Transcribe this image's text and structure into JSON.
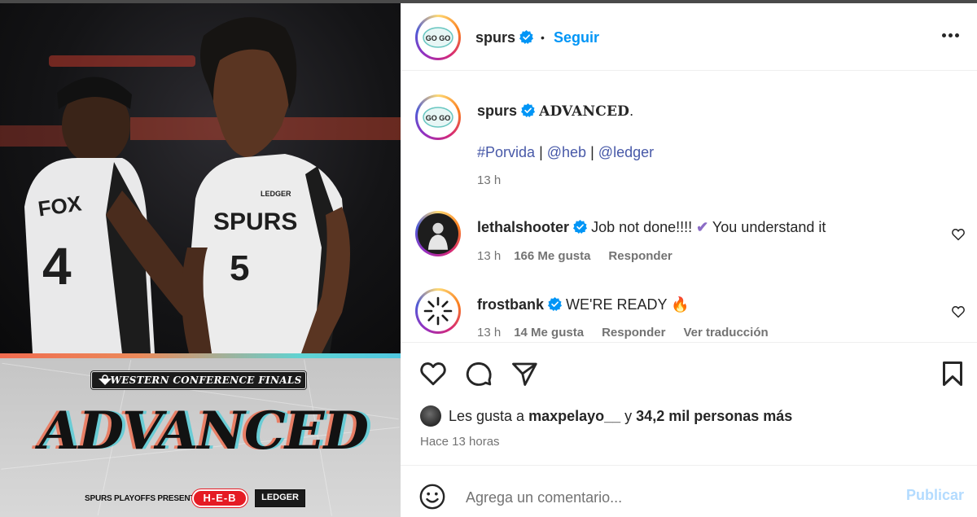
{
  "post_image": {
    "banner_title": "WESTERN CONFERENCE FINALS",
    "headline": "ADVANCED",
    "presented_by": "SPURS PLAYOFFS PRESENTED BY",
    "sponsor_heb": "H-E-B",
    "sponsor_ledger": "LEDGER",
    "jersey_left_name": "FOX",
    "jersey_left_number": "4",
    "jersey_right_team": "SPURS",
    "jersey_right_number": "5",
    "jersey_right_patch": "LEDGER"
  },
  "header": {
    "username": "spurs",
    "separator": "•",
    "follow_label": "Seguir",
    "avatar_text": "GO GO"
  },
  "caption": {
    "username": "spurs",
    "text": "ADVANCED",
    "period": ".",
    "hashtag": "#Porvida",
    "sep1": "|",
    "mention1": "@heb",
    "sep2": "|",
    "mention2": "@ledger",
    "time": "13 h"
  },
  "comments": [
    {
      "username": "lethalshooter",
      "text_before": "Job not done!!!! ",
      "emoji": "✔",
      "text_after": " You understand it",
      "time": "13 h",
      "likes": "166 Me gusta",
      "reply": "Responder"
    },
    {
      "username": "frostbank",
      "text": "WE'RE READY ",
      "emoji": "🔥",
      "time": "13 h",
      "likes": "14 Me gusta",
      "reply": "Responder",
      "translate": "Ver traducción"
    }
  ],
  "likes_line": {
    "prefix": "Les gusta a ",
    "user": "maxpelayo__",
    "middle": " y ",
    "count": "34,2 mil personas más"
  },
  "time_ago": "Hace 13 horas",
  "add_comment": {
    "placeholder": "Agrega un comentario...",
    "publish_label": "Publicar"
  },
  "colors": {
    "link_blue": "#0095f6",
    "hashtag_blue": "#4859a8",
    "publish_disabled": "#b3dbff",
    "meta_gray": "#737373"
  }
}
